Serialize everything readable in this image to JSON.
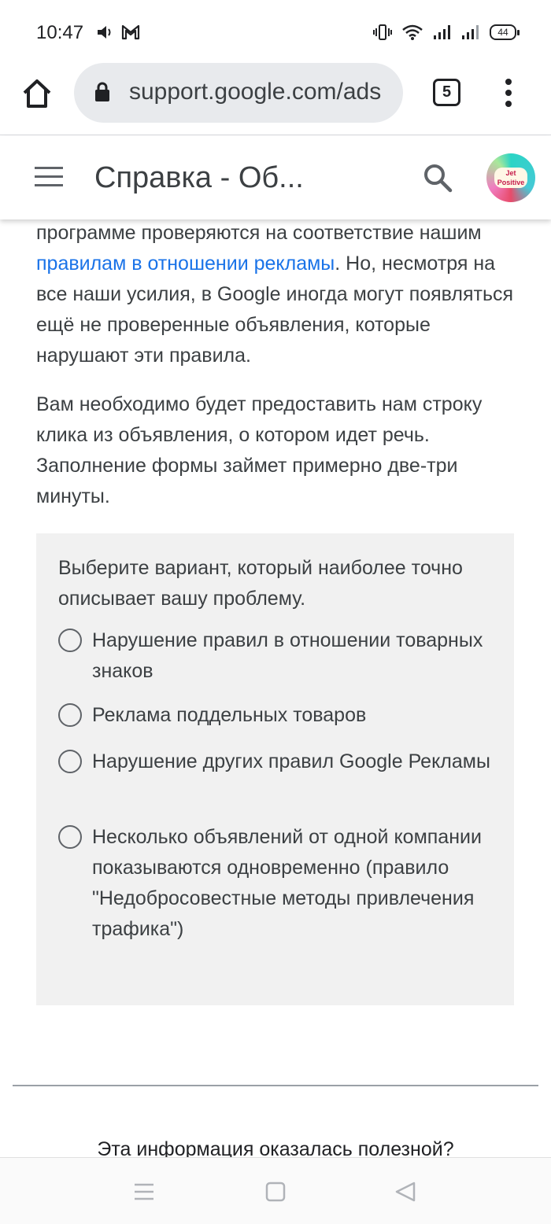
{
  "status_bar": {
    "time": "10:47",
    "left_icons": [
      "sound-icon",
      "gmail-icon"
    ],
    "right_icons": [
      "vibrate-icon",
      "wifi-icon",
      "signal-icon",
      "signal-icon"
    ],
    "battery": "44"
  },
  "browser": {
    "url": "support.google.com/ads",
    "tab_count": "5",
    "icons": [
      "home-icon",
      "lock-icon",
      "more-vert-icon"
    ]
  },
  "header": {
    "title": "Справка - Об...",
    "icons": [
      "menu-icon",
      "search-icon",
      "avatar"
    ],
    "avatar_text_1": "Jet",
    "avatar_text_2": "Positive"
  },
  "content": {
    "para1_before_link": "программе проверяются на соответствие нашим ",
    "para1_link": "правилам в отношении рекламы",
    "para1_after_link": ". Но, несмотря на все наши усилия, в Google иногда могут появляться ещё не проверенные объявления, которые нарушают эти правила.",
    "para2": "Вам необходимо будет предоставить нам строку клика из объявления, о котором идет речь. Заполнение формы займет примерно две-три минуты.",
    "question": "Выберите вариант, который наиболее точно описывает вашу проблему.",
    "options": [
      {
        "label": "Нарушение правил в отношении товарных знаков",
        "selected": false
      },
      {
        "label": "Реклама поддельных товаров",
        "selected": false
      },
      {
        "label": "Нарушение других правил Google Рекламы",
        "selected": false
      },
      {
        "label": "Несколько объявлений от одной компании показываются одновременно (правило \"Недобросовестные методы привлечения трафика\")",
        "selected": false
      }
    ],
    "feedback_question": "Эта информация оказалась полезной?"
  },
  "nav_bar": {
    "icons": [
      "recent-apps-icon",
      "home-square-icon",
      "back-icon"
    ]
  },
  "colors": {
    "link": "#1a73e8",
    "question_bg": "#f1f1f1",
    "url_bg": "#e8eaed"
  }
}
